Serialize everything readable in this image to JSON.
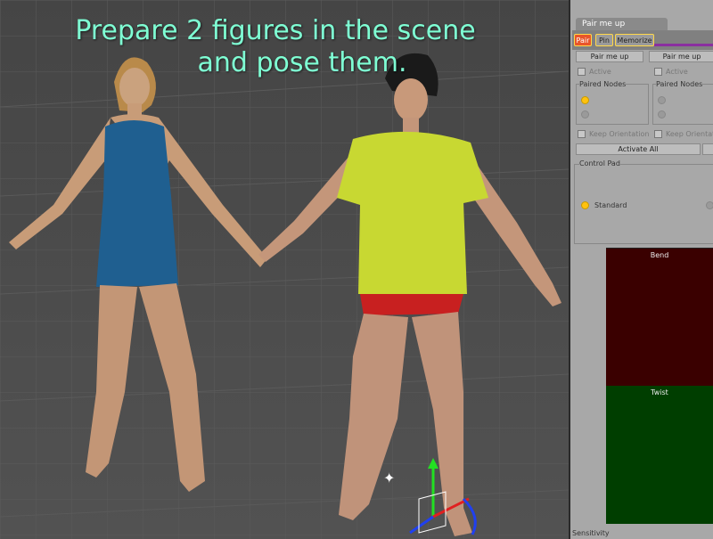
{
  "caption": {
    "line1": "Prepare 2 figures in the scene",
    "line2": "and pose them."
  },
  "panel": {
    "title": "Pair me up",
    "tabs": [
      "Pair",
      "Pin",
      "Memorize"
    ],
    "pair_buttons": [
      "Pair me up",
      "Pair me up"
    ],
    "active_label": "Active",
    "paired_nodes_label": "Paired Nodes",
    "keep_orientation_label": "Keep Orientation",
    "activate_all_label": "Activate All",
    "control_pad_label": "Control Pad",
    "standard_label": "Standard",
    "bend_label": "Bend",
    "twist_label": "Twist",
    "sensitivity_label": "Sensitivity"
  },
  "colors": {
    "caption": "#7fffd4",
    "tab_active": "#e8552a",
    "tab_outline": "#ffd84a",
    "bend_pad": "#3a0000",
    "twist_pad": "#003e00",
    "radio_on": "#ffc20e"
  }
}
